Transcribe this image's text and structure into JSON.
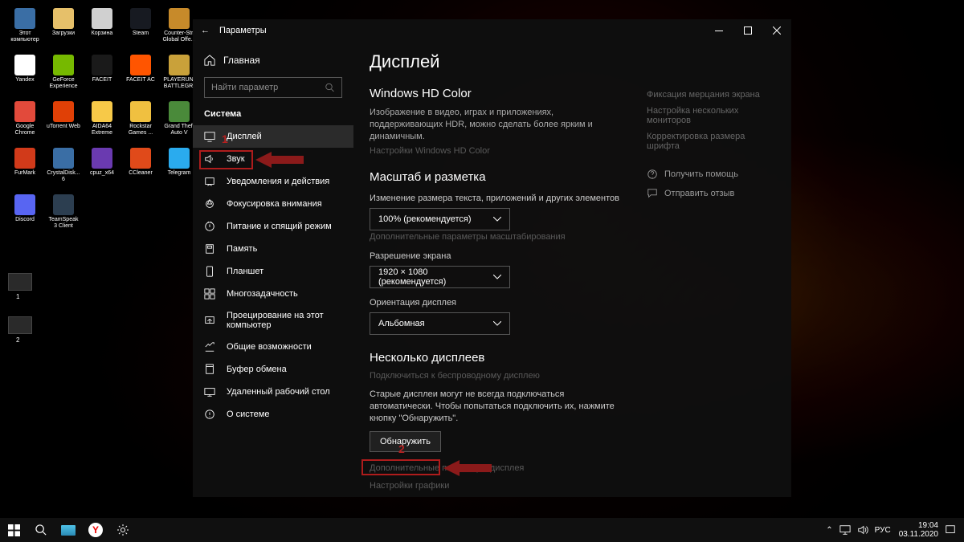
{
  "desktop_icons": [
    {
      "label": "Этот компьютер",
      "color": "#3a6ea5"
    },
    {
      "label": "Загрузки",
      "color": "#e6c06a"
    },
    {
      "label": "Корзина",
      "color": "#d0d0d0"
    },
    {
      "label": "Steam",
      "color": "#171a21"
    },
    {
      "label": "Counter-Str. Global Offe...",
      "color": "#c78a2a"
    },
    {
      "label": "Yandex",
      "color": "#fff"
    },
    {
      "label": "GeForce Experience",
      "color": "#76b900"
    },
    {
      "label": "FACEIT",
      "color": "#1a1a1a"
    },
    {
      "label": "FACEIT AC",
      "color": "#ff5500"
    },
    {
      "label": "PLAYERUN. BATTLEGR.",
      "color": "#c9a13a"
    },
    {
      "label": "Google Chrome",
      "color": "#e24a3b"
    },
    {
      "label": "uTorrent Web",
      "color": "#e04006"
    },
    {
      "label": "AIDA64 Extreme",
      "color": "#f7c948"
    },
    {
      "label": "Rockstar Games ...",
      "color": "#f0c040"
    },
    {
      "label": "Grand Theft Auto V",
      "color": "#4a8a3a"
    },
    {
      "label": "FurMark",
      "color": "#d13a1a"
    },
    {
      "label": "CrystalDisk... 6",
      "color": "#3a6ea5"
    },
    {
      "label": "cpuz_x64",
      "color": "#6a3ab0"
    },
    {
      "label": "CCleaner",
      "color": "#e04a1a"
    },
    {
      "label": "Telegram",
      "color": "#2AABEE"
    },
    {
      "label": "Discord",
      "color": "#5865F2"
    },
    {
      "label": "TeamSpeak 3 Client",
      "color": "#2c3e50"
    }
  ],
  "settings": {
    "window_title": "Параметры",
    "home_label": "Главная",
    "search_placeholder": "Найти параметр",
    "section_title": "Система",
    "items": [
      {
        "label": "Дисплей"
      },
      {
        "label": "Звук"
      },
      {
        "label": "Уведомления и действия"
      },
      {
        "label": "Фокусировка внимания"
      },
      {
        "label": "Питание и спящий режим"
      },
      {
        "label": "Память"
      },
      {
        "label": "Планшет"
      },
      {
        "label": "Многозадачность"
      },
      {
        "label": "Проецирование на этот компьютер"
      },
      {
        "label": "Общие возможности"
      },
      {
        "label": "Буфер обмена"
      },
      {
        "label": "Удаленный рабочий стол"
      },
      {
        "label": "О системе"
      }
    ],
    "content": {
      "title": "Дисплей",
      "hd_heading": "Windows HD Color",
      "hd_desc": "Изображение в видео, играх и приложениях, поддерживающих HDR, можно сделать более ярким и динамичным.",
      "hd_link": "Настройки Windows HD Color",
      "scale_heading": "Масштаб и разметка",
      "scale_label": "Изменение размера текста, приложений и других элементов",
      "scale_value": "100% (рекомендуется)",
      "scale_link": "Дополнительные параметры масштабирования",
      "res_label": "Разрешение экрана",
      "res_value": "1920 × 1080 (рекомендуется)",
      "orient_label": "Ориентация дисплея",
      "orient_value": "Альбомная",
      "multi_heading": "Несколько дисплеев",
      "multi_link": "Подключиться к беспроводному дисплею",
      "multi_desc": "Старые дисплеи могут не всегда подключаться автоматически. Чтобы попытаться подключить их, нажмите кнопку \"Обнаружить\".",
      "detect_button": "Обнаружить",
      "adv_display_link": "Дополнительные параметры дисплея",
      "graphics_link": "Настройки графики"
    },
    "right": {
      "fix_flicker": "Фиксация мерцания экрана",
      "multi_monitor": "Настройка нескольких мониторов",
      "font_size": "Корректировка размера шрифта",
      "get_help": "Получить помощь",
      "feedback": "Отправить отзыв"
    }
  },
  "annotations": {
    "n1": "1",
    "n2": "2"
  },
  "folders": {
    "f1": "1",
    "f2": "2"
  },
  "taskbar": {
    "lang": "РУС",
    "time": "19:04",
    "date": "03.11.2020"
  }
}
